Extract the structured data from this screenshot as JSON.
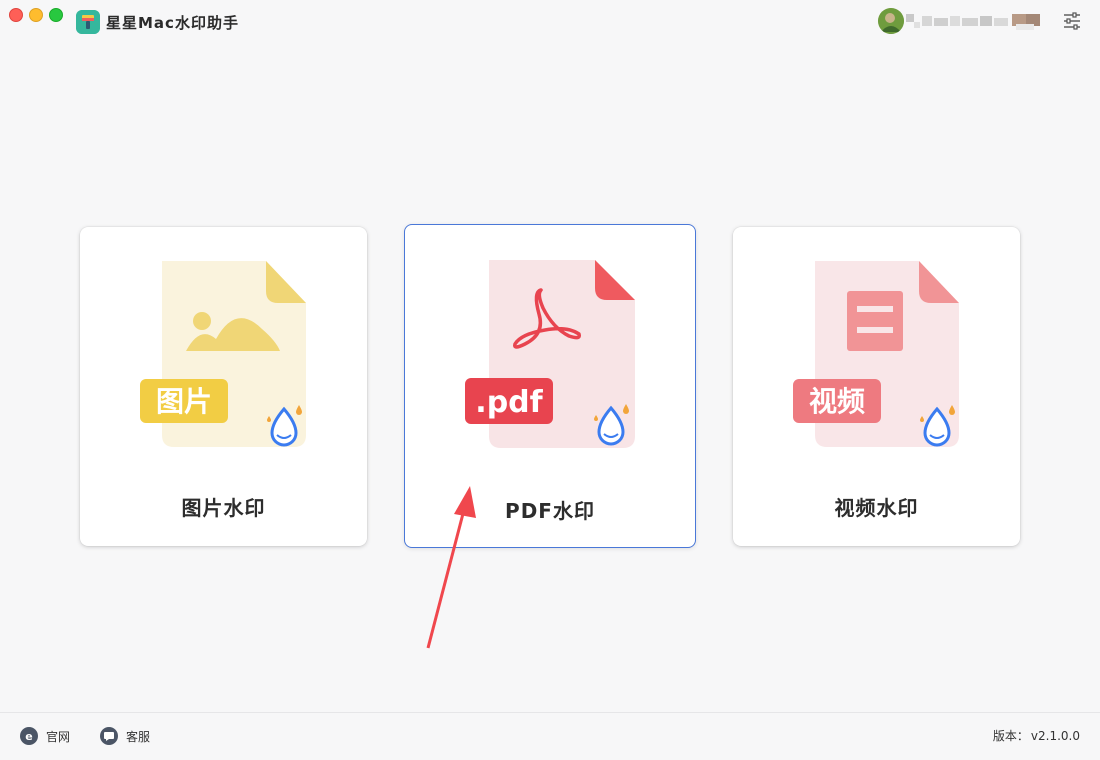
{
  "app": {
    "title": "星星Mac水印助手"
  },
  "user": {
    "name_hidden": "",
    "avatar": "avatar-photo"
  },
  "header": {
    "settings_icon": "sliders-icon"
  },
  "cards": [
    {
      "label": "图片水印",
      "badge": "图片",
      "accent": "#f2d159",
      "paper": "#faf3dd",
      "fold": "#efd77a"
    },
    {
      "label": "PDF水印",
      "badge": ".pdf",
      "accent": "#e8444f",
      "paper": "#f8e4e6",
      "fold": "#ef5a5f"
    },
    {
      "label": "视频水印",
      "badge": "视频",
      "accent": "#ee7a80",
      "paper": "#f9e6e8",
      "fold": "#f19496"
    }
  ],
  "footer": {
    "site_label": "官网",
    "service_label": "客服",
    "version_label": "版本：",
    "version_value": "v2.1.0.0"
  },
  "colors": {
    "selected_border": "#4a78d8",
    "arrow": "#f0474d",
    "drop_blue": "#3b7cf0",
    "drop_orange": "#f2a53a"
  }
}
